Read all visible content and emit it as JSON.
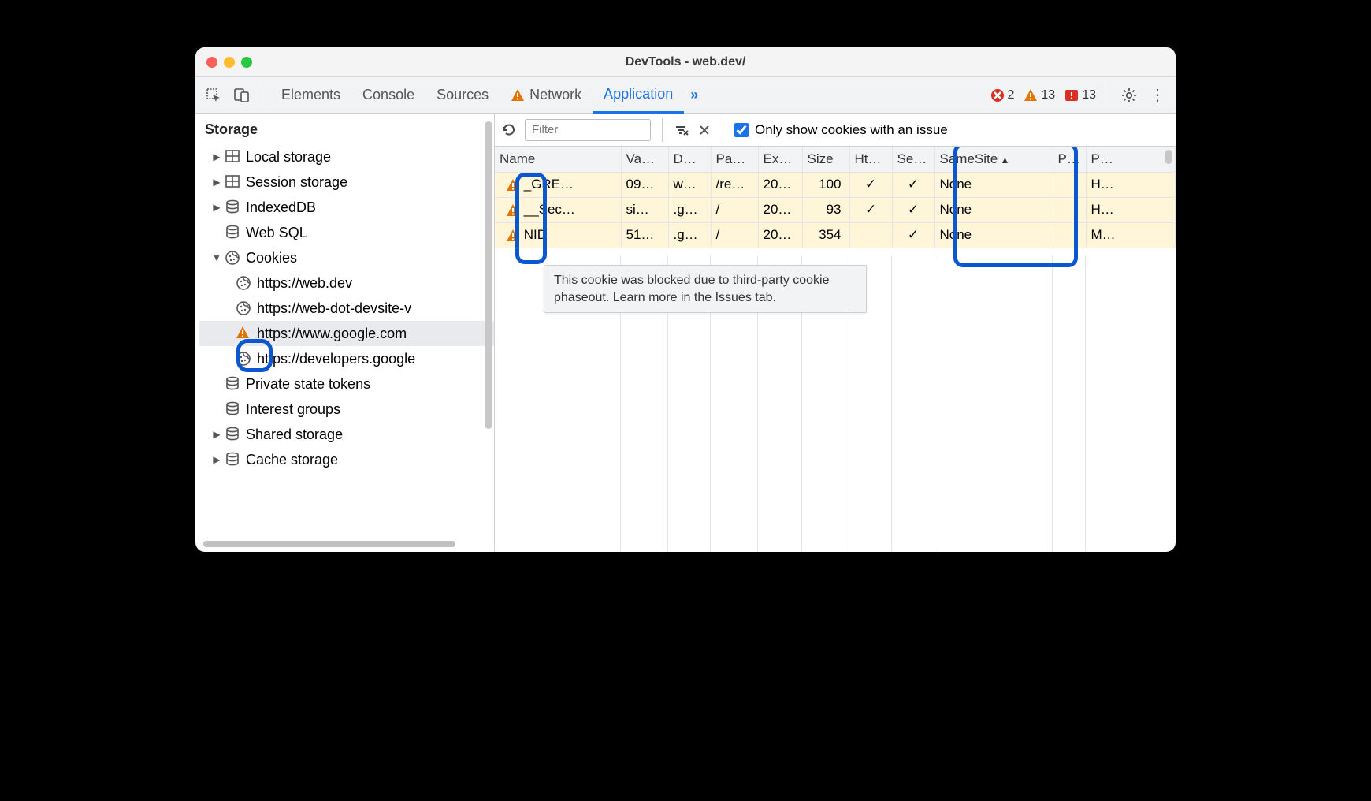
{
  "window": {
    "title": "DevTools - web.dev/"
  },
  "topbar": {
    "tabs": [
      "Elements",
      "Console",
      "Sources",
      "Network",
      "Application"
    ],
    "network_has_warning": true,
    "active_index": 4,
    "more": "»",
    "errors": "2",
    "warnings": "13",
    "issues": "13"
  },
  "sidebar": {
    "section": "Storage",
    "items": [
      {
        "label": "Local storage",
        "icon": "db-grid",
        "expandable": true,
        "expanded": false,
        "level": 1
      },
      {
        "label": "Session storage",
        "icon": "db-grid",
        "expandable": true,
        "expanded": false,
        "level": 1
      },
      {
        "label": "IndexedDB",
        "icon": "db-cyl",
        "expandable": true,
        "expanded": false,
        "level": 1
      },
      {
        "label": "Web SQL",
        "icon": "db-cyl",
        "expandable": false,
        "expanded": false,
        "level": 1
      },
      {
        "label": "Cookies",
        "icon": "cookie",
        "expandable": true,
        "expanded": true,
        "level": 1
      },
      {
        "label": "https://web.dev",
        "icon": "cookie",
        "level": 2
      },
      {
        "label": "https://web-dot-devsite-v",
        "icon": "cookie",
        "level": 2
      },
      {
        "label": "https://www.google.com",
        "icon": "warn",
        "level": 2,
        "selected": true
      },
      {
        "label": "https://developers.google",
        "icon": "cookie",
        "level": 2
      },
      {
        "label": "Private state tokens",
        "icon": "db-cyl",
        "expandable": false,
        "level": 1
      },
      {
        "label": "Interest groups",
        "icon": "db-cyl",
        "expandable": false,
        "level": 1
      },
      {
        "label": "Shared storage",
        "icon": "db-cyl",
        "expandable": true,
        "expanded": false,
        "level": 1
      },
      {
        "label": "Cache storage",
        "icon": "db-cyl",
        "expandable": true,
        "expanded": false,
        "level": 1
      }
    ]
  },
  "toolbar": {
    "filter_placeholder": "Filter",
    "only_issue_label": "Only show cookies with an issue",
    "only_issue_checked": true
  },
  "table": {
    "columns": [
      "Name",
      "Va…",
      "D…",
      "Pa…",
      "Ex…",
      "Size",
      "Ht…",
      "Se…",
      "SameSite",
      "P…",
      "P…"
    ],
    "sort_col": 8,
    "sort_dir": "asc",
    "rows": [
      {
        "warn": true,
        "name": "_GRE…",
        "value": "09…",
        "domain": "w…",
        "path": "/re…",
        "expires": "20…",
        "size": "100",
        "http": "✓",
        "secure": "✓",
        "samesite": "None",
        "partition": "",
        "priority": "H…"
      },
      {
        "warn": true,
        "name": "__Sec…",
        "value": "si…",
        "domain": ".g…",
        "path": "/",
        "expires": "20…",
        "size": "93",
        "http": "✓",
        "secure": "✓",
        "samesite": "None",
        "partition": "",
        "priority": "H…"
      },
      {
        "warn": true,
        "name": "NID",
        "value": "51…",
        "domain": ".g…",
        "path": "/",
        "expires": "20…",
        "size": "354",
        "http": "",
        "secure": "✓",
        "samesite": "None",
        "partition": "",
        "priority": "M…"
      }
    ]
  },
  "tooltip": {
    "text": "This cookie was blocked due to third-party cookie phaseout. Learn more in the Issues tab."
  }
}
